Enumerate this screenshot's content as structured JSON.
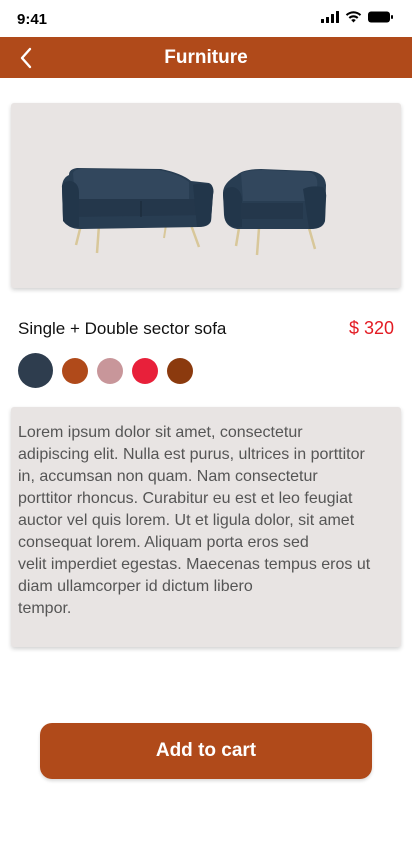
{
  "status_bar": {
    "time": "9:41"
  },
  "header": {
    "title": "Furniture"
  },
  "product": {
    "name": "Single + Double sector sofa",
    "price": "$ 320",
    "colors": [
      "#2e3d4e",
      "#b04a1a",
      "#c8969a",
      "#e8203a",
      "#8b3a0e"
    ],
    "selected_color": 0,
    "description": "Lorem ipsum dolor sit amet, consectetur\nadipiscing elit. Nulla est purus, ultrices in porttitor\nin, accumsan non quam. Nam consectetur\nporttitor rhoncus. Curabitur eu est et leo feugiat\nauctor vel quis lorem. Ut et ligula dolor, sit amet\nconsequat lorem. Aliquam porta eros sed\nvelit imperdiet egestas. Maecenas tempus eros ut\ndiam ullamcorper id dictum libero\ntempor."
  },
  "actions": {
    "add_to_cart_label": "Add to cart"
  }
}
